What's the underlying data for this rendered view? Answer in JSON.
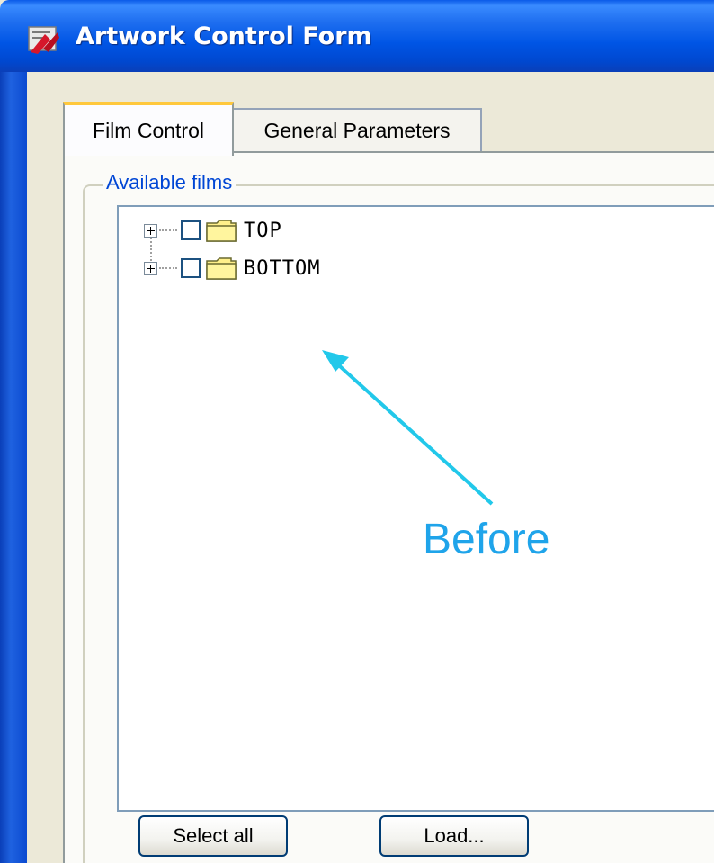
{
  "window": {
    "title": "Artwork Control Form",
    "icon": "artwork-app-icon"
  },
  "tabs": [
    {
      "label": "Film Control",
      "active": true
    },
    {
      "label": "General Parameters",
      "active": false
    }
  ],
  "group": {
    "legend": "Available films"
  },
  "tree": {
    "items": [
      {
        "label": "TOP",
        "checked": false,
        "expanded": false,
        "icon": "folder-icon"
      },
      {
        "label": "BOTTOM",
        "checked": false,
        "expanded": false,
        "icon": "folder-icon"
      }
    ]
  },
  "buttons": {
    "select_all": "Select all",
    "load": "Load..."
  },
  "annotation": {
    "text": "Before",
    "color": "#1fa4ea"
  },
  "colors": {
    "titlebar": "#0055e5",
    "group_legend": "#0046d5",
    "active_tab_highlight": "#ffc83c",
    "folder": "#ffef8a"
  }
}
